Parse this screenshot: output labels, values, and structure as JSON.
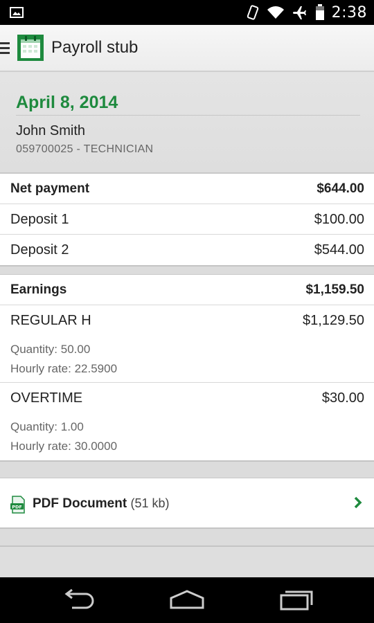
{
  "status_bar": {
    "time": "2:38"
  },
  "action_bar": {
    "title": "Payroll stub"
  },
  "stub": {
    "date": "April 8, 2014",
    "employee_name": "John Smith",
    "employee_id": "059700025 - TECHNICIAN"
  },
  "payment": {
    "net_label": "Net payment",
    "net_amount": "$644.00",
    "deposits": [
      {
        "label": "Deposit 1",
        "amount": "$100.00"
      },
      {
        "label": "Deposit 2",
        "amount": "$544.00"
      }
    ]
  },
  "earnings": {
    "label": "Earnings",
    "total": "$1,159.50",
    "items": [
      {
        "label": "REGULAR H",
        "amount": "$1,129.50",
        "quantity": "Quantity: 50.00",
        "rate": "Hourly rate: 22.5900"
      },
      {
        "label": "OVERTIME",
        "amount": "$30.00",
        "quantity": "Quantity: 1.00",
        "rate": "Hourly rate: 30.0000"
      }
    ]
  },
  "document": {
    "label": "PDF Document",
    "size": "(51 kb)"
  },
  "colors": {
    "accent": "#1e8a3e"
  }
}
